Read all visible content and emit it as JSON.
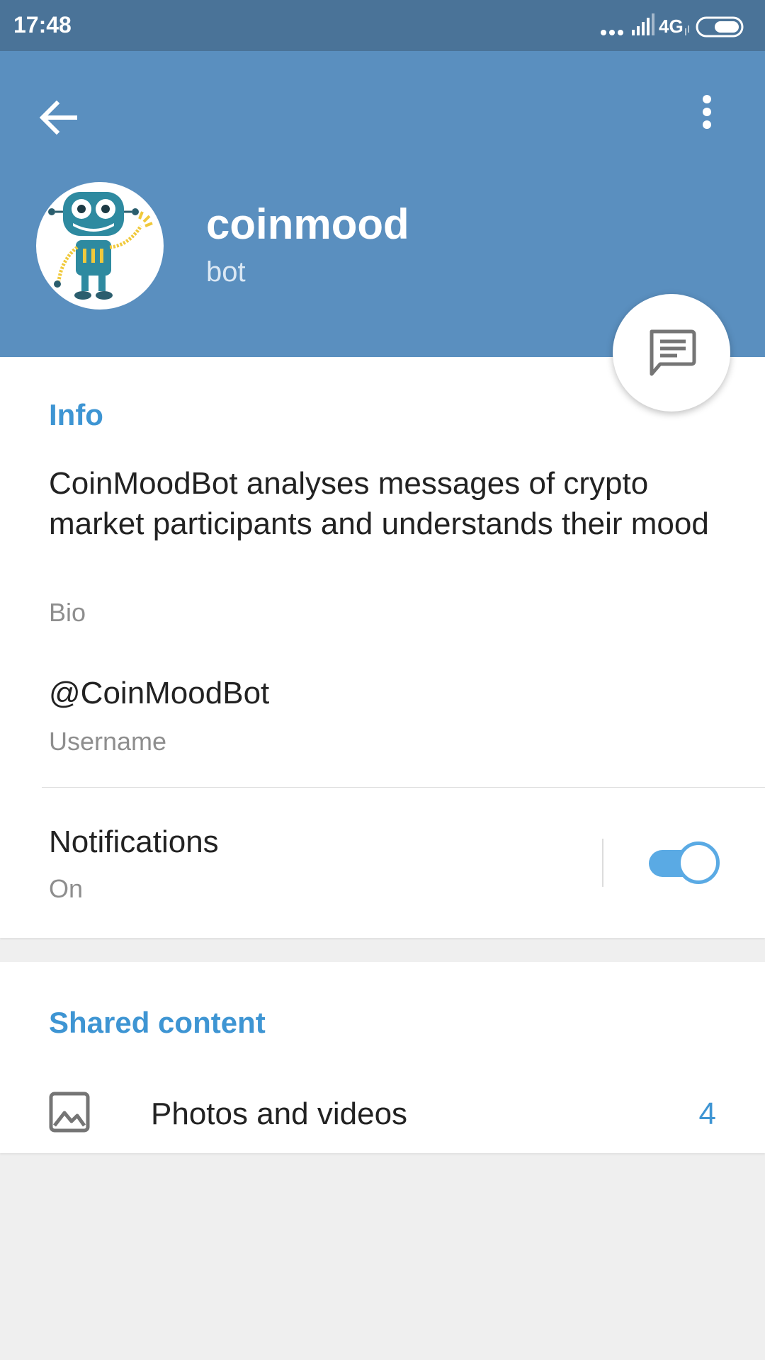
{
  "status_bar": {
    "time": "17:48",
    "network": "4G",
    "icons": [
      "dots-icon",
      "signal-icon",
      "battery-icon"
    ]
  },
  "header": {
    "back_icon": "arrow-back-icon",
    "menu_icon": "more-vertical-icon",
    "name": "coinmood",
    "status": "bot",
    "colors": {
      "header": "#5a8fbf",
      "status_bar": "#4a7398",
      "accent": "#3e95d3"
    }
  },
  "fab": {
    "icon": "chat-bubble-icon"
  },
  "info": {
    "section_title": "Info",
    "bio": "CoinMoodBot analyses messages of crypto market participants and understands their mood",
    "bio_caption": "Bio",
    "username": "@CoinMoodBot",
    "username_caption": "Username",
    "notifications_label": "Notifications",
    "notifications_value": "On",
    "notifications_enabled": true
  },
  "shared": {
    "section_title": "Shared content",
    "photos_label": "Photos and videos",
    "photos_count": "4",
    "photos_icon": "image-icon"
  }
}
